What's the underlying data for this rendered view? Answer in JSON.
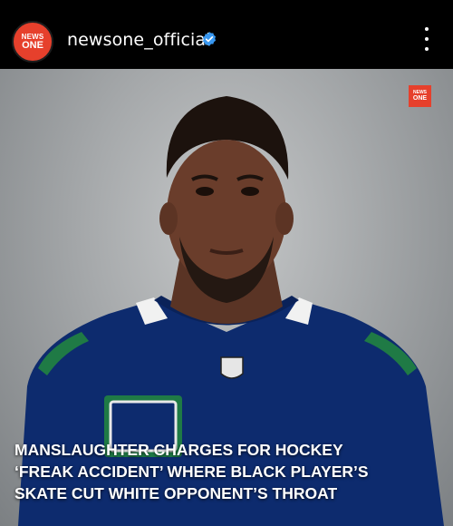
{
  "header": {
    "avatar_line1": "NEWS",
    "avatar_line2": "ONE",
    "username": "newsone_official",
    "verified_icon": "verified-badge-icon",
    "more_icon": "more-options-icon"
  },
  "post": {
    "watermark_line1": "NEWS",
    "watermark_line2": "ONE",
    "headline_lines": [
      "MANSLAUGHTER CHARGES FOR HOCKEY",
      "‘FREAK ACCIDENT’ WHERE BLACK PLAYER’S",
      "SKATE CUT WHITE OPPONENT’S THROAT"
    ]
  },
  "colors": {
    "brand_red": "#e6402c",
    "verified_blue": "#3897f0",
    "jersey_blue": "#0d2b6e"
  }
}
